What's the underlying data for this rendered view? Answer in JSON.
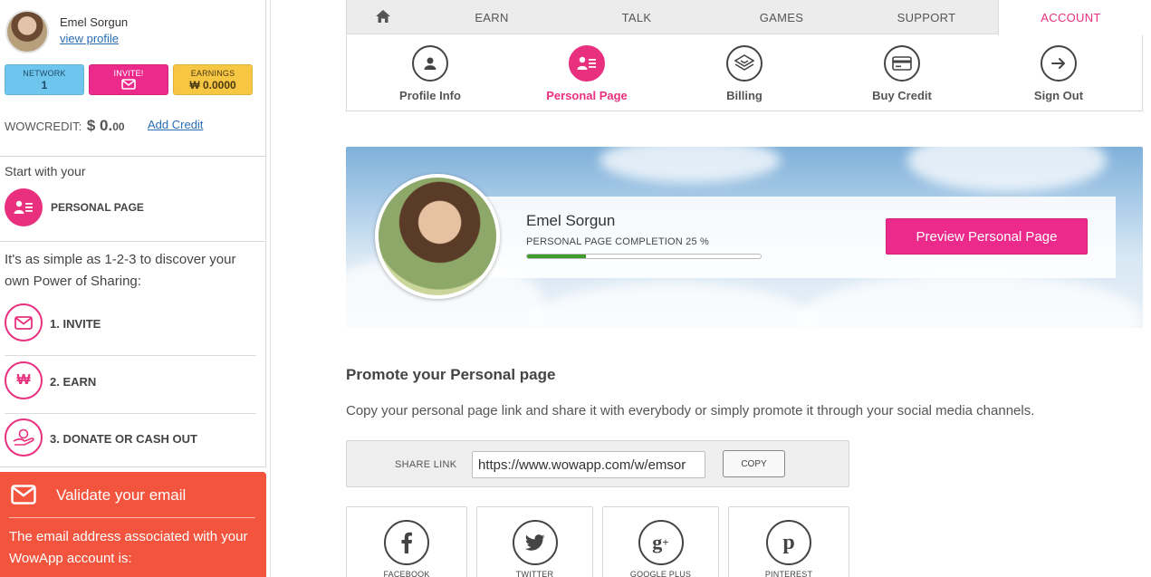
{
  "user": {
    "name": "Emel Sorgun",
    "view_profile": "view profile"
  },
  "stats": {
    "network_label": "NETWORK",
    "network_value": "1",
    "invite_label": "INVITE!",
    "earnings_label": "EARNINGS",
    "earnings_value": "₩ 0.0000"
  },
  "credit": {
    "label": "WOWCREDIT:",
    "amount": "$ 0.",
    "cents": "00",
    "add_link": "Add Credit"
  },
  "start": {
    "title": "Start with your",
    "personal_page": "PERSONAL PAGE"
  },
  "steps": {
    "intro": "It's as simple as 1-2-3 to discover your own Power of Sharing:",
    "items": [
      {
        "label": "1. INVITE",
        "icon": "envelope-icon"
      },
      {
        "label": "2. EARN",
        "icon": "won-icon"
      },
      {
        "label": "3. DONATE OR CASH OUT",
        "icon": "hand-coin-icon"
      }
    ]
  },
  "validate": {
    "title": "Validate your email",
    "text": "The email address associated with your WowApp account is:"
  },
  "tabs": {
    "earn": "EARN",
    "talk": "TALK",
    "games": "GAMES",
    "support": "SUPPORT",
    "account": "ACCOUNT"
  },
  "subnav": [
    {
      "label": "Profile Info",
      "icon": "user-icon",
      "active": false
    },
    {
      "label": "Personal Page",
      "icon": "personal-page-icon",
      "active": true
    },
    {
      "label": "Billing",
      "icon": "billing-icon",
      "active": false
    },
    {
      "label": "Buy Credit",
      "icon": "credit-card-icon",
      "active": false
    },
    {
      "label": "Sign Out",
      "icon": "arrow-right-icon",
      "active": false
    }
  ],
  "profile": {
    "name": "Emel Sorgun",
    "completion_label": "PERSONAL PAGE COMPLETION 25 %",
    "completion_percent": 25,
    "preview_button": "Preview Personal Page"
  },
  "promote": {
    "title": "Promote your Personal page",
    "text": "Copy your personal page link and share it with everybody or simply promote it through your social media channels.",
    "share_label": "SHARE LINK",
    "share_value": "https://www.wowapp.com/w/emsor",
    "copy_button": "COPY"
  },
  "social": [
    {
      "label": "FACEBOOK",
      "glyph": "f"
    },
    {
      "label": "TWITTER",
      "glyph": "t"
    },
    {
      "label": "GOOGLE PLUS",
      "glyph": "g+"
    },
    {
      "label": "PINTEREST",
      "glyph": "p"
    }
  ],
  "colors": {
    "accent": "#e8307f",
    "network": "#6ec6ee",
    "invite": "#ec2a8c",
    "earnings": "#f7c744",
    "validate": "#f2543e",
    "progress": "#3f9c2a"
  }
}
